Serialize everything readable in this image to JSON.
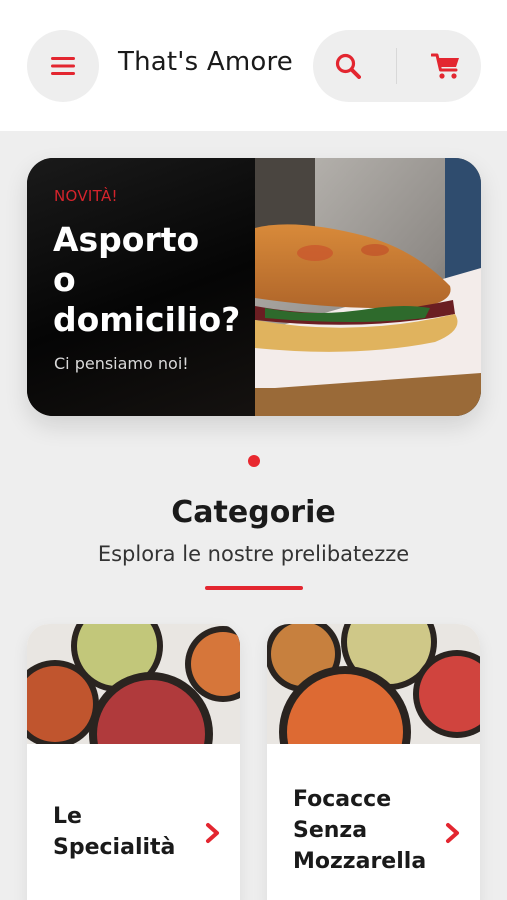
{
  "header": {
    "title": "That's Amore",
    "menu_icon": "hamburger-menu-icon",
    "search_icon": "search-icon",
    "cart_icon": "cart-icon"
  },
  "banner": {
    "tag": "NOVITÀ!",
    "title_lines": [
      "Asporto",
      "o",
      "domicilio?"
    ],
    "subtitle": "Ci pensiamo noi!"
  },
  "carousel": {
    "pages": 1,
    "active": 1
  },
  "section": {
    "title": "Categorie",
    "subtitle": "Esplora le nostre prelibatezze"
  },
  "categories": [
    {
      "label_lines": [
        "Le",
        "Specialità"
      ],
      "icon": "chevron-right-icon"
    },
    {
      "label_lines": [
        "Focacce",
        "Senza",
        "Mozzarella"
      ],
      "icon": "chevron-right-icon"
    }
  ],
  "colors": {
    "accent": "#e32630",
    "background": "#eeeeee",
    "header_bg": "#ffffff",
    "text": "#1a1a1a"
  }
}
